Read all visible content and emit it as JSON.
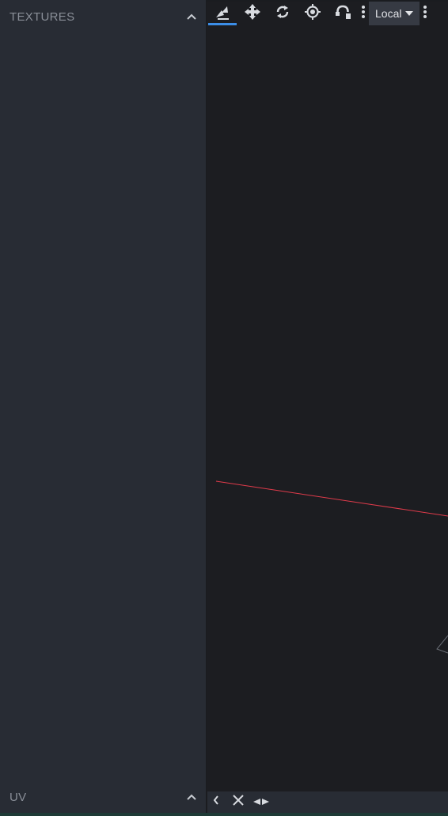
{
  "left_panel": {
    "textures_header": "TEXTURES",
    "uv_header": "UV"
  },
  "toolbar": {
    "tools": [
      {
        "name": "vertex-snap-icon",
        "selected": true
      },
      {
        "name": "move-icon",
        "selected": false
      },
      {
        "name": "rotate-icon",
        "selected": false
      },
      {
        "name": "pivot-icon",
        "selected": false
      },
      {
        "name": "bend-icon",
        "selected": false
      }
    ],
    "transform_space": "Local"
  },
  "bottom_bar": {
    "icons": [
      "chevron-left-icon",
      "close-icon",
      "split-arrows-icon"
    ]
  },
  "colors": {
    "panel_bg": "#282c34",
    "viewport_bg": "#1c1d21",
    "accent": "#3c8ee7",
    "x_axis": "#e03b4b",
    "header_text": "#8a8f98"
  }
}
